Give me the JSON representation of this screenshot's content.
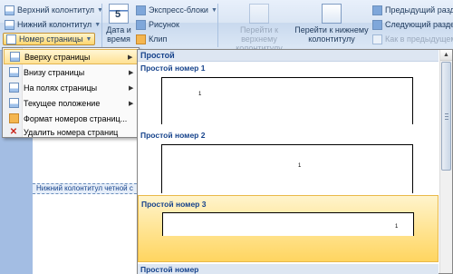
{
  "ribbon": {
    "header_btn": "Верхний колонтитул",
    "footer_btn": "Нижний колонтитул",
    "page_number_btn": "Номер страницы",
    "date_time": [
      "Дата и",
      "время"
    ],
    "calendar_day": "5",
    "express_blocks": "Экспресс-блоки",
    "picture": "Рисунок",
    "clip": "Клип",
    "goto_header": [
      "Перейти к верхнему",
      "колонтитулу"
    ],
    "goto_footer": [
      "Перейти к нижнему",
      "колонтитулу"
    ],
    "prev_section": "Предыдущий раздел",
    "next_section": "Следующий раздел",
    "link_previous": "Как в предыдущем разд"
  },
  "menu": {
    "items": [
      {
        "label": "Вверху страницы",
        "icon": "page-top-icon",
        "submenu": true
      },
      {
        "label": "Внизу страницы",
        "icon": "page-bottom-icon",
        "submenu": true
      },
      {
        "label": "На полях страницы",
        "icon": "page-margin-icon",
        "submenu": true
      },
      {
        "label": "Текущее положение",
        "icon": "current-position-icon",
        "submenu": true
      },
      {
        "label": "Формат номеров страниц...",
        "icon": "format-numbers-icon",
        "submenu": false
      },
      {
        "label": "Удалить номера страниц",
        "icon": "delete-numbers-icon",
        "submenu": false
      }
    ],
    "active_index": 0
  },
  "gallery": {
    "header": "Простой",
    "items": [
      {
        "title": "Простой номер 1",
        "number": "1"
      },
      {
        "title": "Простой номер 2",
        "number": "1"
      },
      {
        "title": "Простой номер 3",
        "number": "1"
      },
      {
        "title": "Простой номер"
      }
    ],
    "selected_index": 2
  },
  "document": {
    "footer_label": "Нижний колонтитул четной с"
  },
  "colors": {
    "ribbon_text": "#15428b",
    "highlight": "#ffe193",
    "highlight_border": "#e3b450"
  }
}
